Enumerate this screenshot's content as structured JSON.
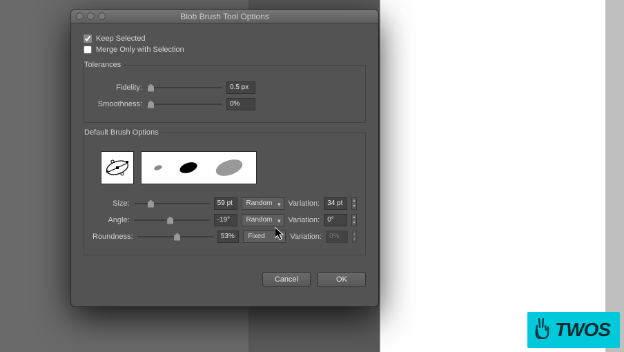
{
  "dialog": {
    "title": "Blob Brush Tool Options",
    "keep_selected": {
      "label": "Keep Selected",
      "checked": true
    },
    "merge_only": {
      "label": "Merge Only with Selection",
      "checked": false
    },
    "tolerances": {
      "heading": "Tolerances",
      "fidelity": {
        "label": "Fidelity:",
        "value": "0.5 px"
      },
      "smoothness": {
        "label": "Smoothness:",
        "value": "0%"
      }
    },
    "brush_options": {
      "heading": "Default Brush Options",
      "size": {
        "label": "Size:",
        "value": "59 pt",
        "mode": "Random",
        "variation_label": "Variation:",
        "variation": "34 pt"
      },
      "angle": {
        "label": "Angle:",
        "value": "-19°",
        "mode": "Random",
        "variation_label": "Variation:",
        "variation": "0°"
      },
      "roundness": {
        "label": "Roundness:",
        "value": "53%",
        "mode": "Fixed",
        "variation_label": "Variation:",
        "variation": "0%"
      }
    },
    "buttons": {
      "cancel": "Cancel",
      "ok": "OK"
    }
  },
  "brand": {
    "text": "TWOS"
  }
}
